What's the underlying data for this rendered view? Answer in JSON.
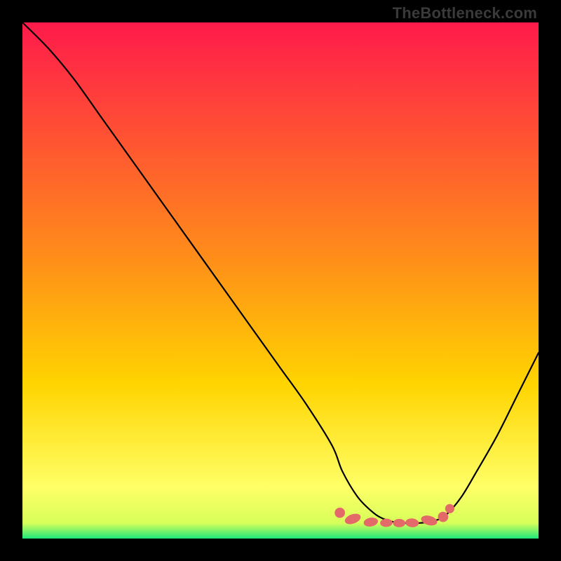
{
  "watermark": "TheBottleneck.com",
  "chart_data": {
    "type": "line",
    "title": "",
    "xlabel": "",
    "ylabel": "",
    "xlim": [
      0,
      100
    ],
    "ylim": [
      0,
      100
    ],
    "grid": false,
    "background_gradient": {
      "top_color": "#ff1a4b",
      "mid_color": "#ffd400",
      "near_bottom_color": "#ffff66",
      "bottom_color": "#1ee87a"
    },
    "series": [
      {
        "name": "curve",
        "color": "#000000",
        "x": [
          0,
          5,
          10,
          15,
          20,
          25,
          30,
          35,
          40,
          45,
          50,
          55,
          60,
          62,
          65,
          68,
          70,
          72,
          74,
          76,
          78,
          80,
          82,
          85,
          88,
          92,
          96,
          100
        ],
        "y": [
          100,
          95,
          89,
          82,
          75,
          68,
          61,
          54,
          47,
          40,
          33,
          26,
          18,
          13,
          8,
          5,
          3.8,
          3.2,
          3.0,
          3.0,
          3.1,
          3.5,
          4.5,
          8,
          13,
          20,
          28,
          36
        ]
      }
    ],
    "markers": {
      "name": "valley_dots",
      "shape": "ellipse",
      "color": "#e46a6a",
      "points": [
        {
          "x": 61.5,
          "y": 5.0,
          "rx": 1.0,
          "ry": 1.0
        },
        {
          "x": 64.0,
          "y": 3.8,
          "rx": 1.6,
          "ry": 0.9,
          "rot": -20
        },
        {
          "x": 67.5,
          "y": 3.2,
          "rx": 1.4,
          "ry": 0.85,
          "rot": -10
        },
        {
          "x": 70.5,
          "y": 3.05,
          "rx": 1.2,
          "ry": 0.8,
          "rot": -3
        },
        {
          "x": 73.0,
          "y": 3.0,
          "rx": 1.2,
          "ry": 0.8,
          "rot": 0
        },
        {
          "x": 75.5,
          "y": 3.05,
          "rx": 1.3,
          "ry": 0.85,
          "rot": 5
        },
        {
          "x": 78.8,
          "y": 3.5,
          "rx": 1.6,
          "ry": 0.9,
          "rot": 15
        },
        {
          "x": 81.5,
          "y": 4.2,
          "rx": 1.0,
          "ry": 1.0
        },
        {
          "x": 82.8,
          "y": 5.8,
          "rx": 0.9,
          "ry": 0.9
        }
      ]
    }
  }
}
